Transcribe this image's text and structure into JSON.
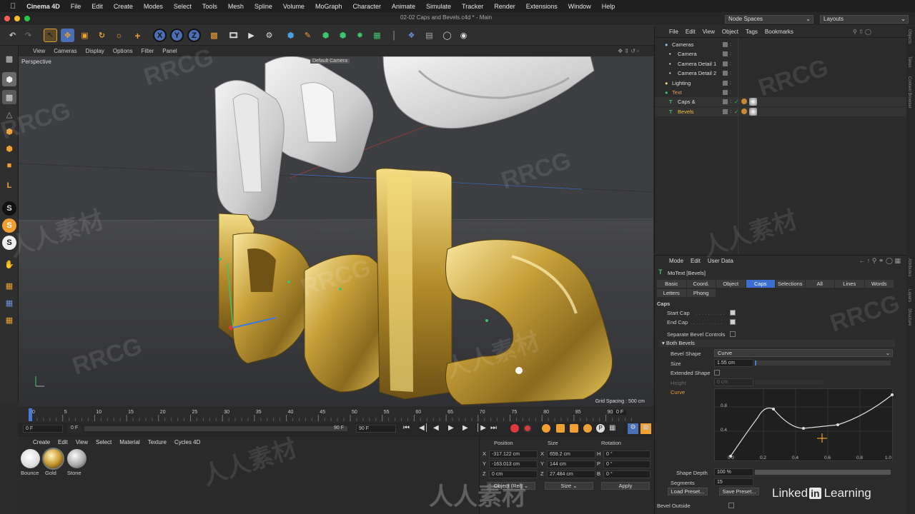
{
  "menubar": {
    "app": "Cinema 4D",
    "items": [
      "File",
      "Edit",
      "Create",
      "Modes",
      "Select",
      "Tools",
      "Mesh",
      "Spline",
      "Volume",
      "MoGraph",
      "Character",
      "Animate",
      "Simulate",
      "Tracker",
      "Render",
      "Extensions",
      "Window",
      "Help"
    ]
  },
  "window": {
    "title": "02-02 Caps and Bevels.c4d * - Main",
    "node_spaces": "Node Spaces",
    "layouts": "Layouts"
  },
  "toolbar": {
    "axis_x": "X",
    "axis_y": "Y",
    "axis_z": "Z"
  },
  "viewport": {
    "menu": [
      "View",
      "Cameras",
      "Display",
      "Options",
      "Filter",
      "Panel"
    ],
    "view_name": "Perspective",
    "camera_label": "Default Camera",
    "grid_spacing": "Grid Spacing : 500 cm",
    "text_caps": "Caps",
    "text_bevels": "Bevels"
  },
  "timeline": {
    "ticks": [
      "0",
      "5",
      "10",
      "15",
      "20",
      "25",
      "30",
      "35",
      "40",
      "45",
      "50",
      "55",
      "60",
      "65",
      "70",
      "75",
      "80",
      "85",
      "90"
    ],
    "current_frame": "0 F",
    "start": "0 F",
    "min": "0 F",
    "max": "90 F",
    "end": "90 F"
  },
  "materials": {
    "menu": [
      "Create",
      "Edit",
      "View",
      "Select",
      "Material",
      "Texture",
      "Cycles 4D"
    ],
    "items": [
      "Bounce",
      "Gold",
      "Stone"
    ]
  },
  "coords": {
    "headers": [
      "Position",
      "Size",
      "Rotation"
    ],
    "rows": [
      {
        "axis": "X",
        "pos": "-317.122 cm",
        "size_axis": "X",
        "size": "659.2 cm",
        "rot_axis": "H",
        "rot": "0 °"
      },
      {
        "axis": "Y",
        "pos": "-163.013 cm",
        "size_axis": "Y",
        "size": "144 cm",
        "rot_axis": "P",
        "rot": "0 °"
      },
      {
        "axis": "Z",
        "pos": "0 cm",
        "size_axis": "Z",
        "size": "27.484 cm",
        "rot_axis": "B",
        "rot": "0 °"
      }
    ],
    "mode1": "Object (Rel)",
    "mode2": "Size",
    "apply": "Apply"
  },
  "objects": {
    "menu": [
      "File",
      "Edit",
      "View",
      "Object",
      "Tags",
      "Bookmarks"
    ],
    "rows": [
      {
        "name": "Cameras",
        "indent": 0
      },
      {
        "name": "Camera",
        "indent": 1
      },
      {
        "name": "Camera Detail 1",
        "indent": 1
      },
      {
        "name": "Camera Detail 2",
        "indent": 1
      },
      {
        "name": "Lighting",
        "indent": 0
      },
      {
        "name": "Text",
        "indent": 0
      },
      {
        "name": "Caps &",
        "indent": 1
      },
      {
        "name": "Bevels",
        "indent": 1
      }
    ]
  },
  "attributes": {
    "menu": [
      "Mode",
      "Edit",
      "User Data"
    ],
    "object_title": "MoText [Bevels]",
    "tabs": [
      "Basic",
      "Coord.",
      "Object",
      "Caps",
      "Selections",
      "All",
      "Lines",
      "Words"
    ],
    "tabs2": [
      "Letters",
      "Phong"
    ],
    "section": "Caps",
    "start_cap": "Start Cap",
    "end_cap": "End Cap",
    "separate": "Separate Bevel Controls",
    "both_bevels": "Both Bevels",
    "bevel_shape": "Bevel Shape",
    "bevel_shape_val": "Curve",
    "size": "Size",
    "size_val": "1.55 cm",
    "extended": "Extended Shape",
    "height": "Height",
    "height_val": "0 cm",
    "curve": "Curve",
    "shape_depth": "Shape Depth",
    "shape_depth_val": "100 %",
    "segments": "Segments",
    "segments_val": "15",
    "load": "Load Preset...",
    "save": "Save Preset...",
    "bevel_outside": "Bevel Outside",
    "curve_y": [
      "0.8",
      "0.4"
    ],
    "curve_x": [
      "0.0",
      "0.2",
      "0.4",
      "0.6",
      "0.8",
      "1.0"
    ]
  },
  "side_tabs": [
    "Objects",
    "Takes",
    "Content Browser",
    "Attributes",
    "Layers",
    "Structure"
  ],
  "branding": {
    "linkedin": "Linked",
    "learning": "Learning",
    "in": "in"
  },
  "watermarks": {
    "rrcg": "RRCG",
    "cn": "人人素材"
  }
}
